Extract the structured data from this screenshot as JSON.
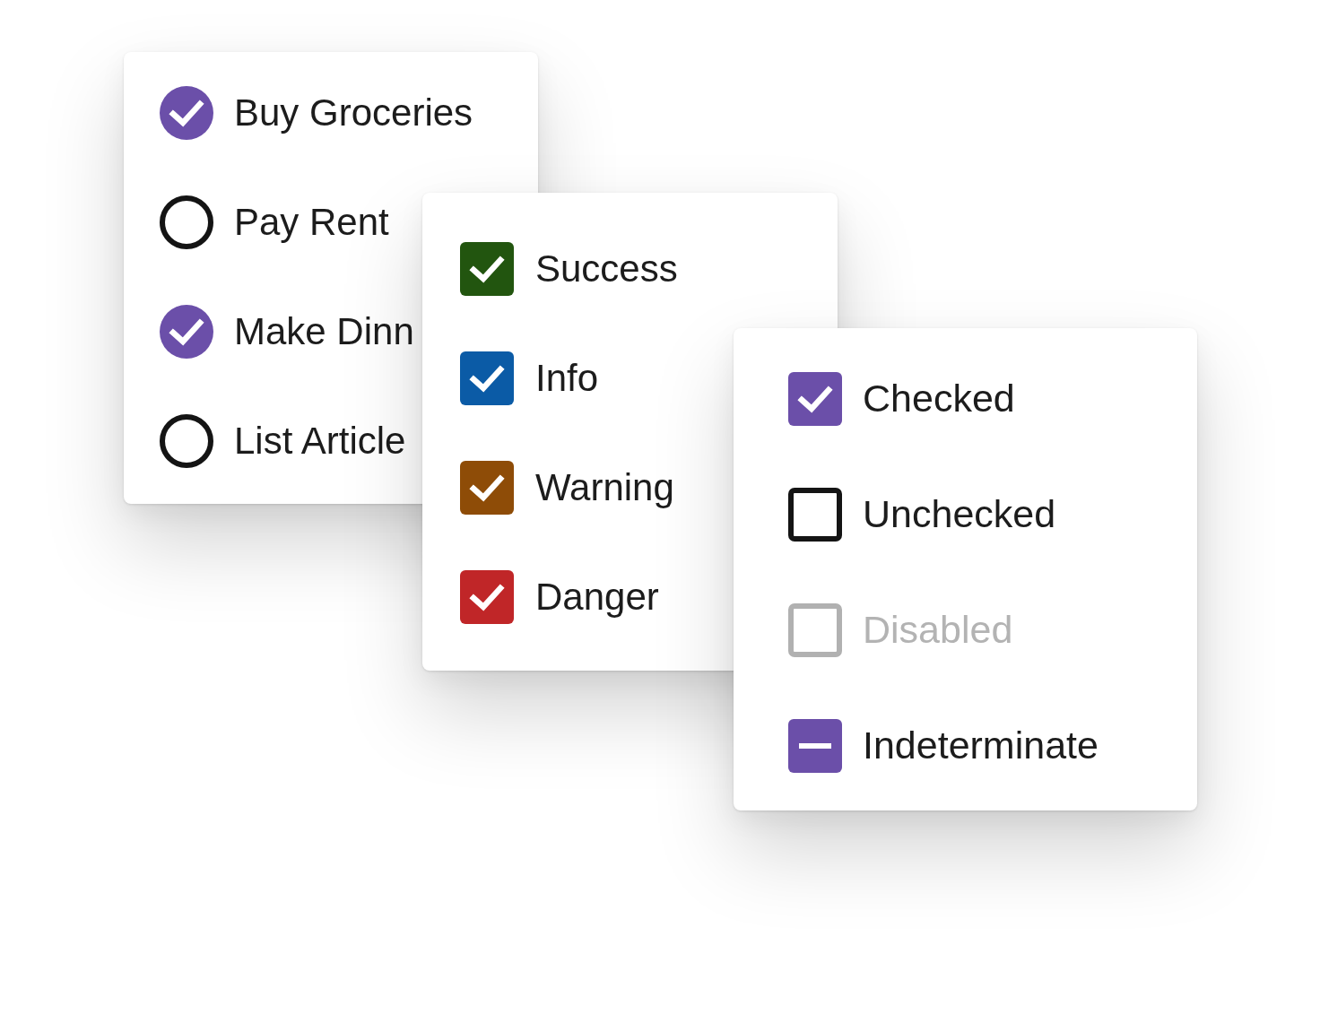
{
  "panels": [
    {
      "kind": "round",
      "items": [
        {
          "label": "Buy Groceries",
          "checked": true
        },
        {
          "label": "Pay Rent",
          "checked": false
        },
        {
          "label": "Make Dinn",
          "checked": true
        },
        {
          "label": "List Article",
          "checked": false
        }
      ]
    },
    {
      "kind": "square",
      "items": [
        {
          "label": "Success",
          "checked": true,
          "color": "#22550f"
        },
        {
          "label": "Info",
          "checked": true,
          "color": "#0b5ba6"
        },
        {
          "label": "Warning",
          "checked": true,
          "color": "#8e4c07"
        },
        {
          "label": "Danger",
          "checked": true,
          "color": "#c02628"
        }
      ]
    },
    {
      "kind": "square",
      "items": [
        {
          "label": "Checked",
          "checked": true,
          "indeterminate": false,
          "disabled": false
        },
        {
          "label": "Unchecked",
          "checked": false,
          "indeterminate": false,
          "disabled": false
        },
        {
          "label": "Disabled",
          "checked": false,
          "indeterminate": false,
          "disabled": true
        },
        {
          "label": "Indeterminate",
          "checked": false,
          "indeterminate": true,
          "disabled": false
        }
      ]
    }
  ]
}
